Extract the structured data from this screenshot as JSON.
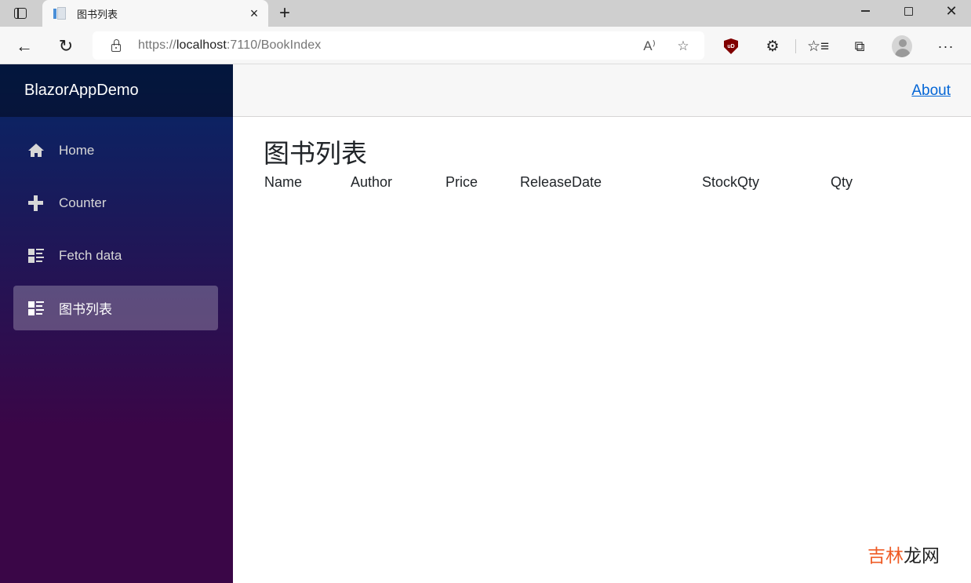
{
  "browser": {
    "tab": {
      "title": "图书列表",
      "close_glyph": "×"
    },
    "new_tab_glyph": "+",
    "window_controls": {
      "minimize": "minimize-icon",
      "maximize": "maximize-icon",
      "close_glyph": "✕"
    },
    "nav": {
      "back_glyph": "←",
      "reload_glyph": "↻"
    },
    "address": {
      "scheme": "https://",
      "host": "localhost",
      "rest": ":7110/BookIndex"
    },
    "omnibox_icons": {
      "read_aloud_glyph": "A⁾",
      "add_favorite_glyph": "☆"
    },
    "extensions": {
      "ublock_label": "uD",
      "puzzle_glyph": "⚙",
      "favorites_glyph": "☆≡",
      "collections_glyph": "⧉",
      "more_glyph": "···"
    }
  },
  "app": {
    "brand": "BlazorAppDemo",
    "sidebar": {
      "items": [
        {
          "label": "Home",
          "icon": "home-icon",
          "active": false
        },
        {
          "label": "Counter",
          "icon": "plus-icon",
          "active": false
        },
        {
          "label": "Fetch data",
          "icon": "list-rich-icon",
          "active": false
        },
        {
          "label": "图书列表",
          "icon": "list-rich-icon",
          "active": true
        }
      ]
    },
    "topbar": {
      "about_label": "About"
    },
    "main": {
      "title": "图书列表",
      "table": {
        "columns": [
          "Name",
          "Author",
          "Price",
          "ReleaseDate",
          "StockQty",
          "Qty"
        ],
        "rows": []
      }
    }
  },
  "watermark": {
    "part1": "吉林",
    "part2": "龙网"
  }
}
